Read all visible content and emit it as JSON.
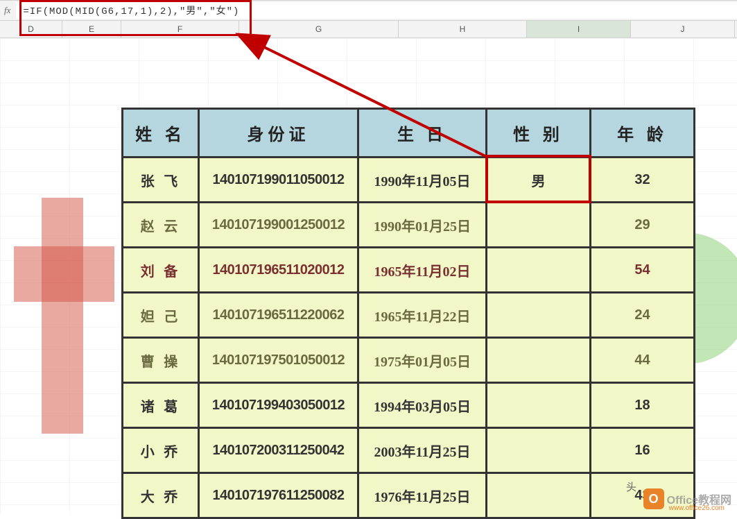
{
  "formula_bar": {
    "fx_label": "fx",
    "formula": "=IF(MOD(MID(G6,17,1),2),\"男\",\"女\")"
  },
  "column_headers": {
    "D": "D",
    "E": "E",
    "F": "F",
    "G": "G",
    "H": "H",
    "I": "I",
    "J": "J"
  },
  "table": {
    "headers": {
      "name": "姓 名",
      "id": "身份证",
      "birthday": "生 日",
      "gender": "性 别",
      "age": "年 龄"
    },
    "rows": [
      {
        "name": "张 飞",
        "id": "140107199011050012",
        "birthday": "1990年11月05日",
        "gender": "男",
        "age": "32"
      },
      {
        "name": "赵 云",
        "id": "140107199001250012",
        "birthday": "1990年01月25日",
        "gender": "",
        "age": "29"
      },
      {
        "name": "刘 备",
        "id": "140107196511020012",
        "birthday": "1965年11月02日",
        "gender": "",
        "age": "54"
      },
      {
        "name": "妲 己",
        "id": "140107196511220062",
        "birthday": "1965年11月22日",
        "gender": "",
        "age": "24"
      },
      {
        "name": "曹 操",
        "id": "140107197501050012",
        "birthday": "1975年01月05日",
        "gender": "",
        "age": "44"
      },
      {
        "name": "诸 葛",
        "id": "140107199403050012",
        "birthday": "1994年03月05日",
        "gender": "",
        "age": "18"
      },
      {
        "name": "小 乔",
        "id": "140107200311250042",
        "birthday": "2003年11月25日",
        "gender": "",
        "age": "16"
      },
      {
        "name": "大 乔",
        "id": "140107197611250082",
        "birthday": "1976年11月25日",
        "gender": "",
        "age": "43"
      }
    ]
  },
  "watermark": {
    "head_text": "头",
    "brand": "Office教程网",
    "logo_letter": "O",
    "url": "www.office26.com"
  }
}
